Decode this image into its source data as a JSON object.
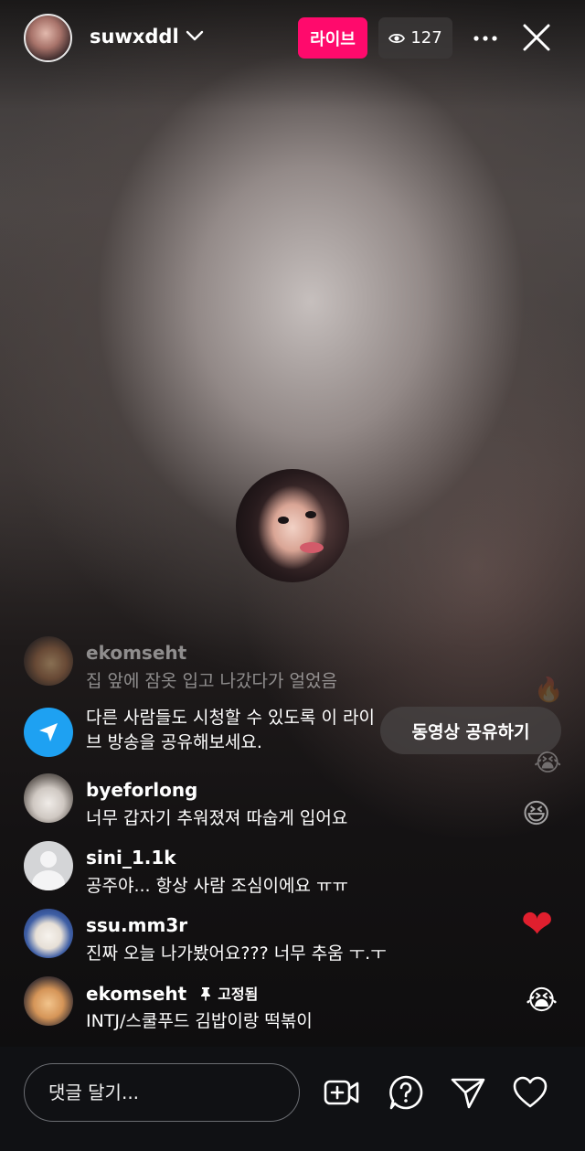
{
  "header": {
    "username": "suwxddl",
    "live_label": "라이브",
    "viewer_count": "127"
  },
  "comments_top": {
    "username": "ekomseht",
    "text": "집 앞에 잠옷 입고 나갔다가 얼었음"
  },
  "share_prompt": {
    "text": "다른 사람들도 시청할 수 있도록 이 라이브 방송을 공유해보세요.",
    "button_label": "동영상 공유하기"
  },
  "comments": [
    {
      "username": "byeforlong",
      "text": "너무 갑자기 추워졌져 따숩게 입어요"
    },
    {
      "username": "sini_1.1k",
      "text": "공주야... 항상 사람 조심이에요 ㅠㅠ"
    },
    {
      "username": "ssu.mm3r",
      "text": "진짜 오늘 나가봤어요??? 너무 추움 ㅜ.ㅜ"
    },
    {
      "username": "ekomseht",
      "pinned_label": "고정됨",
      "text": "INTJ/스쿨푸드 김밥이랑 떡볶이"
    }
  ],
  "reactions": [
    "heart",
    "crying-face",
    "grinning-squint-face",
    "crying-face",
    "fire"
  ],
  "bottom": {
    "comment_placeholder": "댓글 달기..."
  },
  "colors": {
    "live_badge": "#ff0a6c",
    "share_icon": "#1ea1f2",
    "bottom_bar": "#101114"
  }
}
